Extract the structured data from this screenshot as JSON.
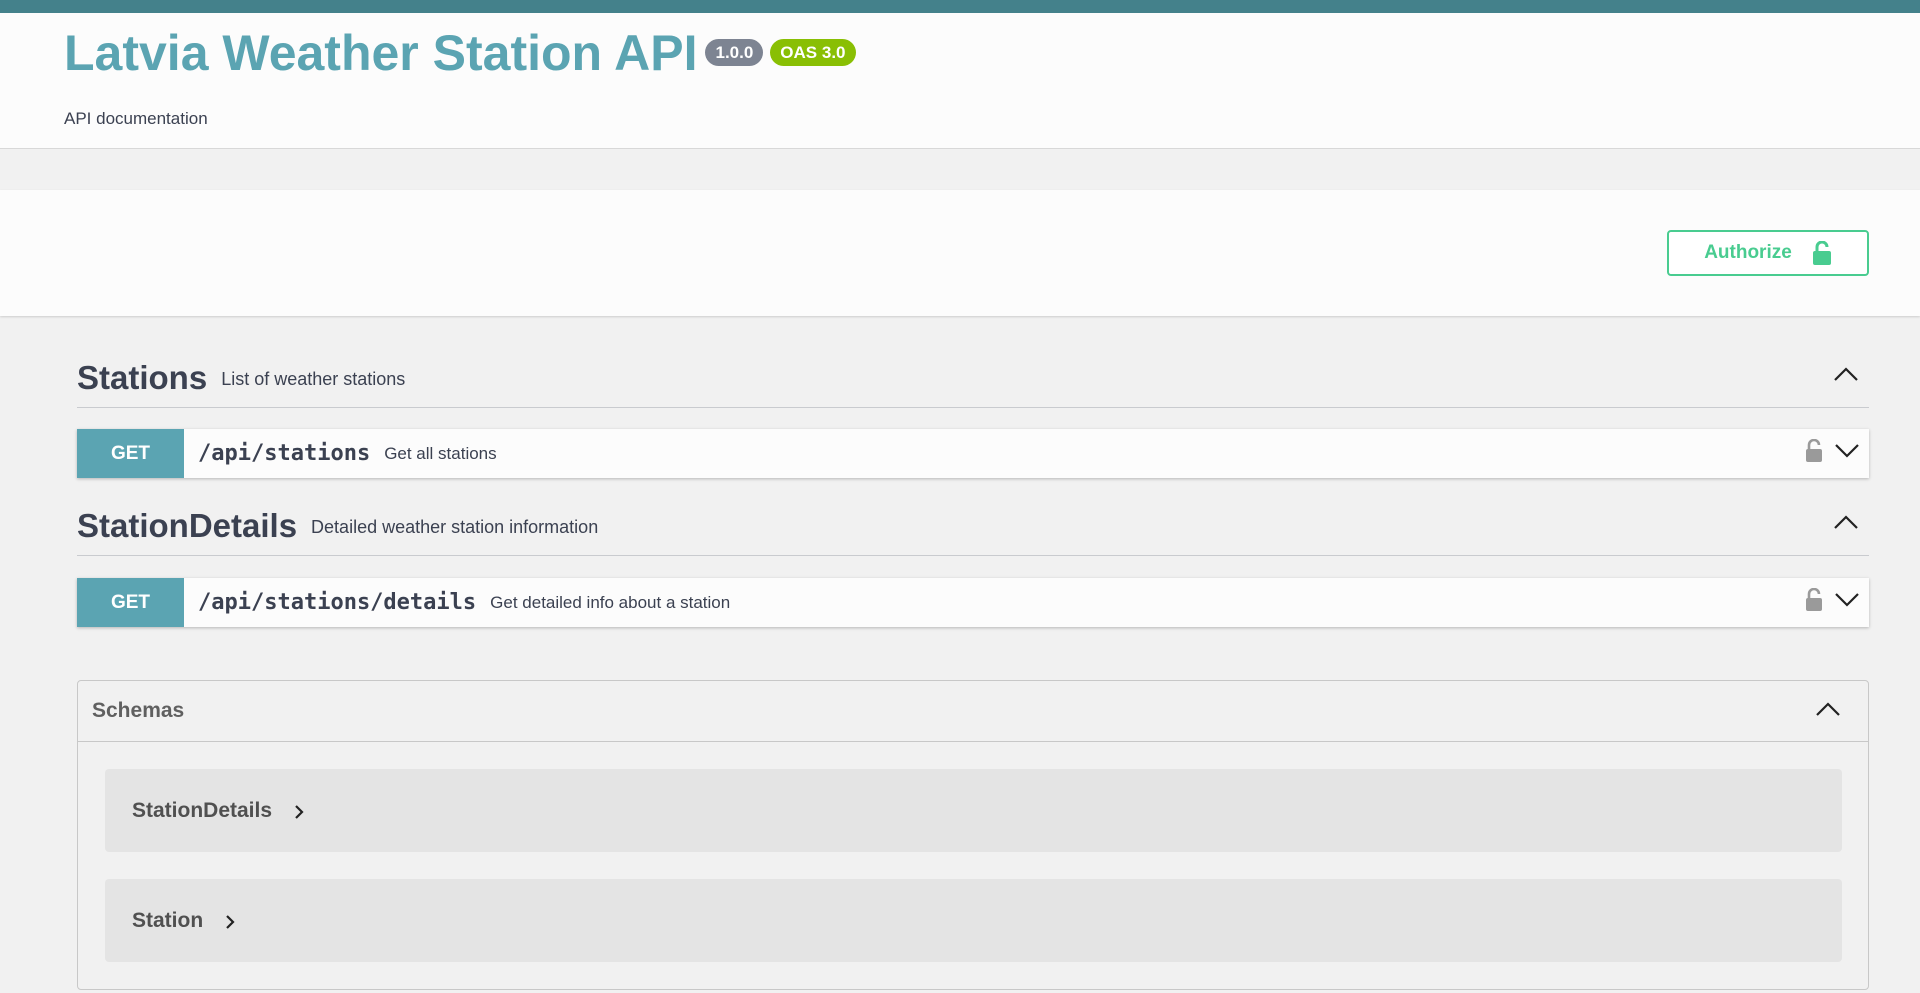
{
  "info": {
    "title": "Latvia Weather Station API",
    "version_badge": "1.0.0",
    "oas_badge": "OAS 3.0",
    "description": "API documentation"
  },
  "auth": {
    "authorize_label": "Authorize"
  },
  "tags": [
    {
      "name": "Stations",
      "description": "List of weather stations",
      "operations": [
        {
          "method": "GET",
          "path": "/api/stations",
          "summary": "Get all stations"
        }
      ]
    },
    {
      "name": "StationDetails",
      "description": "Detailed weather station information",
      "operations": [
        {
          "method": "GET",
          "path": "/api/stations/details",
          "summary": "Get detailed info about a station"
        }
      ]
    }
  ],
  "schemas": {
    "title": "Schemas",
    "models": [
      "StationDetails",
      "Station"
    ]
  },
  "colors": {
    "topbar": "#44818b",
    "title": "#5ba4b2",
    "get_method": "#5ba4b2",
    "authorize": "#49cc90",
    "oas_badge": "#89bf04",
    "version_badge": "#7d8492"
  }
}
